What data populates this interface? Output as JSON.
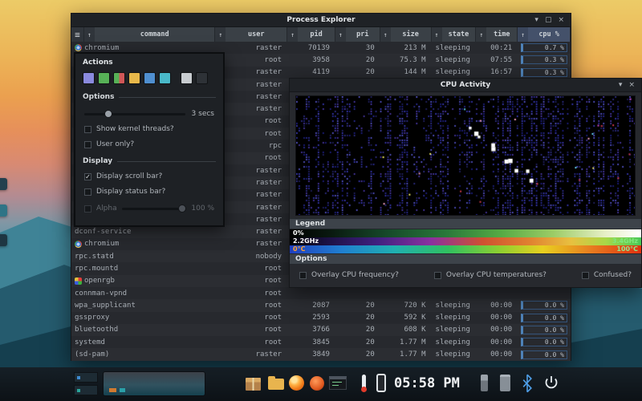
{
  "process_explorer": {
    "title": "Process Explorer",
    "menu_icon": "≡",
    "sort_icon": "↑",
    "controls": [
      {
        "name": "shade-icon",
        "glyph": "▾"
      },
      {
        "name": "maximize-icon",
        "glyph": "▢"
      },
      {
        "name": "close-icon",
        "glyph": "×"
      }
    ],
    "columns": [
      "command",
      "user",
      "pid",
      "pri",
      "size",
      "state",
      "time",
      "cpu %"
    ],
    "rows": [
      {
        "icon": "chromium",
        "cmd": "chromium",
        "user": "raster",
        "pid": "70139",
        "pri": "30",
        "size": "213 M",
        "state": "sleeping",
        "time": "00:21",
        "cpu": "0.7 %"
      },
      {
        "cmd": "",
        "user": "root",
        "pid": "3958",
        "pri": "20",
        "size": "75.3 M",
        "state": "sleeping",
        "time": "07:55",
        "cpu": "0.3 %"
      },
      {
        "cmd": "",
        "user": "raster",
        "pid": "4119",
        "pri": "20",
        "size": "144 M",
        "state": "sleeping",
        "time": "16:57",
        "cpu": "0.3 %"
      },
      {
        "cmd": "",
        "user": "raster",
        "pid": "",
        "pri": "",
        "size": "",
        "state": "",
        "time": "",
        "cpu": ""
      },
      {
        "cmd": "",
        "user": "raster",
        "pid": "",
        "pri": "",
        "size": "",
        "state": "",
        "time": "",
        "cpu": ""
      },
      {
        "cmd": "",
        "user": "raster",
        "pid": "",
        "pri": "",
        "size": "",
        "state": "",
        "time": "",
        "cpu": ""
      },
      {
        "cmd": "",
        "user": "root",
        "pid": "",
        "pri": "",
        "size": "",
        "state": "",
        "time": "",
        "cpu": ""
      },
      {
        "cmd": "",
        "user": "root",
        "pid": "",
        "pri": "",
        "size": "",
        "state": "",
        "time": "",
        "cpu": ""
      },
      {
        "cmd": "",
        "user": "rpc",
        "pid": "",
        "pri": "",
        "size": "",
        "state": "",
        "time": "",
        "cpu": ""
      },
      {
        "cmd": "",
        "user": "root",
        "pid": "",
        "pri": "",
        "size": "",
        "state": "",
        "time": "",
        "cpu": ""
      },
      {
        "cmd": "",
        "user": "raster",
        "pid": "",
        "pri": "",
        "size": "",
        "state": "",
        "time": "",
        "cpu": ""
      },
      {
        "cmd": "",
        "user": "raster",
        "pid": "",
        "pri": "",
        "size": "",
        "state": "",
        "time": "",
        "cpu": ""
      },
      {
        "cmd": "",
        "user": "raster",
        "pid": "",
        "pri": "",
        "size": "",
        "state": "",
        "time": "",
        "cpu": ""
      },
      {
        "cmd": "",
        "user": "raster",
        "pid": "",
        "pri": "",
        "size": "",
        "state": "",
        "time": "",
        "cpu": ""
      },
      {
        "cmd": "",
        "user": "raster",
        "pid": "",
        "pri": "",
        "size": "",
        "state": "",
        "time": "",
        "cpu": ""
      },
      {
        "cmd": "dconf-service",
        "user": "raster",
        "pid": "",
        "pri": "",
        "size": "",
        "state": "",
        "time": "",
        "cpu": ""
      },
      {
        "icon": "chromium",
        "cmd": "chromium",
        "user": "raster",
        "pid": "",
        "pri": "",
        "size": "",
        "state": "",
        "time": "",
        "cpu": ""
      },
      {
        "cmd": "rpc.statd",
        "user": "nobody",
        "pid": "",
        "pri": "",
        "size": "",
        "state": "",
        "time": "",
        "cpu": ""
      },
      {
        "cmd": "rpc.mountd",
        "user": "root",
        "pid": "",
        "pri": "",
        "size": "",
        "state": "",
        "time": "",
        "cpu": ""
      },
      {
        "icon": "openrgb",
        "cmd": "openrgb",
        "user": "root",
        "pid": "",
        "pri": "",
        "size": "",
        "state": "",
        "time": "",
        "cpu": ""
      },
      {
        "cmd": "connman-vpnd",
        "user": "root",
        "pid": "",
        "pri": "",
        "size": "",
        "state": "",
        "time": "",
        "cpu": ""
      },
      {
        "cmd": "wpa_supplicant",
        "user": "root",
        "pid": "2087",
        "pri": "20",
        "size": "720 K",
        "state": "sleeping",
        "time": "00:00",
        "cpu": "0.0 %"
      },
      {
        "cmd": "gssproxy",
        "user": "root",
        "pid": "2593",
        "pri": "20",
        "size": "592 K",
        "state": "sleeping",
        "time": "00:00",
        "cpu": "0.0 %"
      },
      {
        "cmd": "bluetoothd",
        "user": "root",
        "pid": "3766",
        "pri": "20",
        "size": "608 K",
        "state": "sleeping",
        "time": "00:00",
        "cpu": "0.0 %"
      },
      {
        "cmd": "systemd",
        "user": "root",
        "pid": "3845",
        "pri": "20",
        "size": "1.77 M",
        "state": "sleeping",
        "time": "00:00",
        "cpu": "0.0 %"
      },
      {
        "cmd": "(sd-pam)",
        "user": "raster",
        "pid": "3849",
        "pri": "20",
        "size": "1.77 M",
        "state": "sleeping",
        "time": "00:00",
        "cpu": "0.0 %"
      }
    ]
  },
  "actions_panel": {
    "title": "Actions",
    "buttons": [
      {
        "name": "processes-icon",
        "color": "#8a8ade"
      },
      {
        "name": "run-icon",
        "color": "#57b157"
      },
      {
        "name": "start-stop-icon",
        "color": "#57b157|#d05757"
      },
      {
        "name": "priority-icon",
        "color": "#e8b84a"
      },
      {
        "name": "cpu-icon",
        "color": "#4f8fd0"
      },
      {
        "name": "memory-icon",
        "color": "#49b8c8"
      },
      {
        "name": "tools-icon",
        "color": "#c8ccd0"
      },
      {
        "name": "terminal-icon",
        "color": "#2e3237"
      }
    ],
    "options_label": "Options",
    "poll_value": "3 secs",
    "kernel_label": "Show kernel threads?",
    "useronly_label": "User only?",
    "display_label": "Display",
    "check_glyph": "✓",
    "scrollbar_label": "Display scroll bar?",
    "statusbar_label": "Display status bar?",
    "alpha_label": "Alpha",
    "alpha_value": "100 %"
  },
  "cpu_window": {
    "title": "CPU Activity",
    "controls": [
      {
        "name": "shade-icon",
        "glyph": "▾"
      },
      {
        "name": "close-icon",
        "glyph": "×"
      }
    ],
    "legend_label": "Legend",
    "legend_rows": [
      {
        "kind": "util",
        "left": "0%",
        "left_color": "#ffffff",
        "right": "",
        "right_color": "#ffffff"
      },
      {
        "kind": "freq",
        "left": "2.2GHz",
        "left_color": "#ffffff",
        "right": "3.4GHz",
        "right_color": "#7ee87e"
      },
      {
        "kind": "temp",
        "left": "0°C",
        "left_color": "#ffa030",
        "right": "100°C",
        "right_color": "#90e890"
      }
    ],
    "options_label": "Options",
    "option_checks": [
      "Overlay CPU frequency?",
      "Overlay CPU temperatures?",
      "Confused?"
    ]
  },
  "taskbar": {
    "clock": "05:58 PM"
  }
}
